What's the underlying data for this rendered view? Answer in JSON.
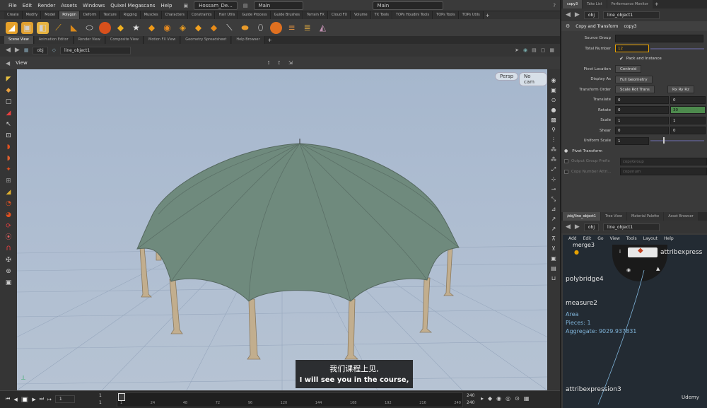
{
  "menubar": {
    "items": [
      "File",
      "Edit",
      "Render",
      "Assets",
      "Windows",
      "Quixel Megascans",
      "Help"
    ],
    "scene_file": "Hossam_De...",
    "desktop": "Main",
    "desktop2": "Main"
  },
  "shelf_tabs": [
    "Create",
    "Modify",
    "Model",
    "Polygon",
    "Deform",
    "Texture",
    "Rigging",
    "Muscles",
    "Characters",
    "Constraints",
    "Hair Utils",
    "Guide Process",
    "Guide Brushes",
    "Terrain FX",
    "Cloud FX",
    "Volume",
    "TX Tools",
    "TOPs Houdini Tools",
    "TOPs Tools",
    "TOPs Utils"
  ],
  "shelf_active": "Polygon",
  "pane_tabs": [
    "Scene View",
    "Animation Editor",
    "Render View",
    "Composite View",
    "Motion FX View",
    "Geometry Spreadsheet",
    "Help Browser"
  ],
  "pane_active": "Scene View",
  "path": {
    "context": "obj",
    "node": "line_object1"
  },
  "view": {
    "title": "View",
    "persp": "Persp",
    "cam": "No cam"
  },
  "timeline": {
    "frame": "1",
    "start1": "1",
    "start2": "1",
    "ticks": [
      "1",
      "24",
      "48",
      "72",
      "96",
      "120",
      "144",
      "168",
      "192",
      "216",
      "240"
    ],
    "end1": "240",
    "end2": "240"
  },
  "right_top": {
    "tabs": [
      "copy3",
      "Take List",
      "Performance Monitor"
    ],
    "path_context": "obj",
    "path_node": "line_object1",
    "node_type": "Copy and Transform",
    "node_name": "copy3"
  },
  "params": {
    "source_group_label": "Source Group",
    "total_number_label": "Total Number",
    "total_number": "12",
    "pack_label": "Pack and Instance",
    "pivot_location_label": "Pivot Location",
    "pivot_location": "Centroid",
    "display_as_label": "Display As",
    "display_as": "Full Geometry",
    "transform_order_label": "Transform Order",
    "transform_order": "Scale Rot Trans",
    "rot_order": "Rx Ry Rz",
    "translate_label": "Translate",
    "translate": [
      "0",
      "0"
    ],
    "rotate_label": "Rotate",
    "rotate": [
      "0",
      "30"
    ],
    "scale_label": "Scale",
    "scale": [
      "1",
      "1"
    ],
    "shear_label": "Shear",
    "shear": [
      "0",
      "0"
    ],
    "uniform_scale_label": "Uniform Scale",
    "uniform_scale": "1",
    "pivot_transform_label": "Pivot Transform",
    "output_group_label": "Output Group Prefix",
    "output_group_value": "copyGroup",
    "copy_number_label": "Copy Number Attri...",
    "copy_number_value": "copynum"
  },
  "network": {
    "tabs": [
      "/obj/line_object1",
      "Tree View",
      "Material Palette",
      "Asset Browser"
    ],
    "path_context": "obj",
    "path_node": "line_object1",
    "menu": [
      "Add",
      "Edit",
      "Go",
      "View",
      "Tools",
      "Layout",
      "Help"
    ],
    "node_merge": "merge3",
    "node_attrib_top": "attribexpress",
    "node_polybridge": "polybridge4",
    "node_measure": "measure2",
    "info_area": "Area",
    "info_pieces": "Pieces: 1",
    "info_aggregate": "Aggregate: 9029.937831",
    "node_attrib_bottom": "attribexpression3",
    "watermark": "Udemy"
  },
  "subtitle": {
    "zh": "我们课程上见,",
    "en": "I will see you in the course,"
  },
  "colors": {
    "accent_orange": "#e8a200",
    "green_field": "#4d8a4d",
    "dome": "#6f8a7d"
  }
}
